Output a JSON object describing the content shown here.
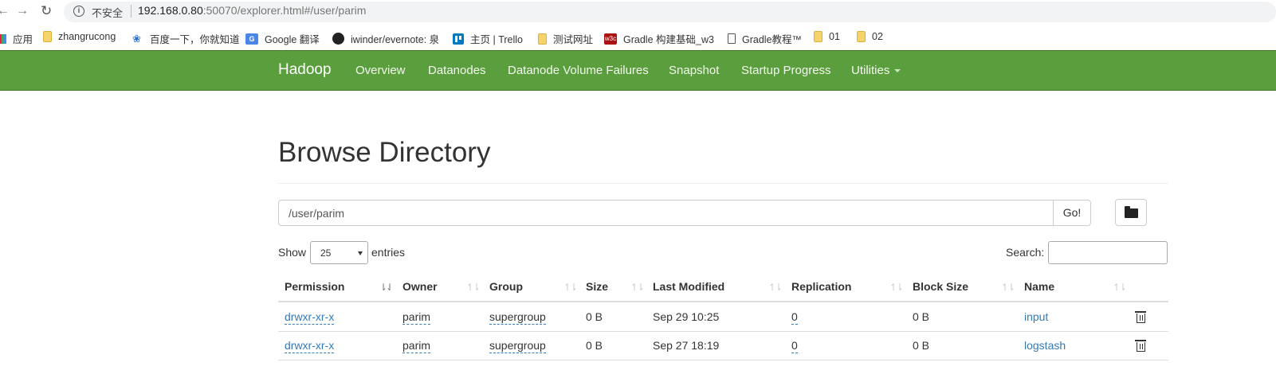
{
  "browser": {
    "security_label": "不安全",
    "url_host": "192.168.0.80",
    "url_rest": ":50070/explorer.html#/user/parim",
    "bookmarks": [
      {
        "label": "应用",
        "icon": "apps-icon"
      },
      {
        "label": "zhangrucong",
        "icon": "folder-icon"
      },
      {
        "label": "百度一下，你就知道",
        "icon": "baidu-paw-icon"
      },
      {
        "label": "Google 翻译",
        "icon": "google-translate-icon"
      },
      {
        "label": "iwinder/evernote: 泉",
        "icon": "github-icon"
      },
      {
        "label": "主页 | Trello",
        "icon": "trello-icon"
      },
      {
        "label": "测试网址",
        "icon": "folder-icon"
      },
      {
        "label": "Gradle 构建基础_w3",
        "icon": "w3c-icon"
      },
      {
        "label": "Gradle教程™",
        "icon": "document-icon"
      },
      {
        "label": "01",
        "icon": "folder-icon"
      },
      {
        "label": "02",
        "icon": "folder-icon"
      }
    ]
  },
  "navbar": {
    "brand": "Hadoop",
    "items": [
      "Overview",
      "Datanodes",
      "Datanode Volume Failures",
      "Snapshot",
      "Startup Progress",
      "Utilities"
    ]
  },
  "main": {
    "title": "Browse Directory",
    "path_value": "/user/parim",
    "go_label": "Go!",
    "show_label": "Show",
    "entries_value": "25",
    "entries_label": "entries",
    "search_label": "Search:"
  },
  "table": {
    "headers": [
      "Permission",
      "Owner",
      "Group",
      "Size",
      "Last Modified",
      "Replication",
      "Block Size",
      "Name"
    ],
    "rows": [
      {
        "permission": "drwxr-xr-x",
        "owner": "parim",
        "group": "supergroup",
        "size": "0 B",
        "modified": "Sep 29 10:25",
        "replication": "0",
        "block_size": "0 B",
        "name": "input"
      },
      {
        "permission": "drwxr-xr-x",
        "owner": "parim",
        "group": "supergroup",
        "size": "0 B",
        "modified": "Sep 27 18:19",
        "replication": "0",
        "block_size": "0 B",
        "name": "logstash"
      }
    ]
  }
}
